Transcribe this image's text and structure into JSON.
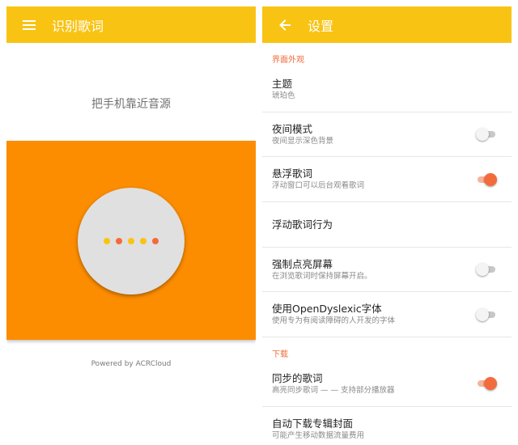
{
  "colors": {
    "primary": "#f9c313",
    "panel": "#fc8c00",
    "accent": "#f36b3c",
    "dots": [
      "#f9c313",
      "#f36b3c",
      "#f9c313",
      "#f9c313",
      "#f36b3c"
    ]
  },
  "identify": {
    "title": "识别歌词",
    "nav_icon": "menu-icon",
    "prompt": "把手机靠近音源",
    "powered_by": "Powered by ACRCloud"
  },
  "settings": {
    "title": "设置",
    "nav_icon": "arrow-back-icon",
    "sections": [
      {
        "header": "界面外观",
        "items": [
          {
            "title": "主题",
            "subtitle": "琥珀色"
          },
          {
            "title": "夜间模式",
            "subtitle": "夜间显示深色背景",
            "switch": false
          },
          {
            "title": "悬浮歌词",
            "subtitle": "浮动窗口可以后台观看歌词",
            "switch": true
          },
          {
            "title": "浮动歌词行为"
          },
          {
            "title": "强制点亮屏幕",
            "subtitle": "在浏览歌词时保持屏幕开启。",
            "switch": false
          },
          {
            "title": "使用OpenDyslexic字体",
            "subtitle": "使用专为有阅读障碍的人开发的字体",
            "switch": false
          }
        ]
      },
      {
        "header": "下载",
        "items": [
          {
            "title": "同步的歌词",
            "subtitle": "高亮同步歌词 — — 支持部分播放器",
            "switch": true
          },
          {
            "title": "自动下载专辑封面",
            "subtitle": "可能产生移动数据流量费用"
          }
        ]
      }
    ]
  }
}
